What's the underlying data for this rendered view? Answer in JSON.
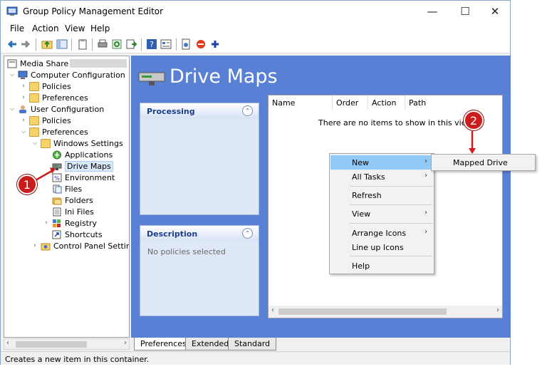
{
  "window": {
    "title": "Group Policy Management Editor",
    "controls": {
      "minimize": "—",
      "maximize": "☐",
      "close": "✕"
    }
  },
  "menu": [
    "File",
    "Action",
    "View",
    "Help"
  ],
  "tree": {
    "root": "Media Share",
    "items": [
      {
        "label": "Computer Configuration",
        "icon": "computer-icon"
      },
      {
        "label": "Policies",
        "icon": "folder-icon"
      },
      {
        "label": "Preferences",
        "icon": "folder-icon"
      },
      {
        "label": "User Configuration",
        "icon": "user-icon"
      },
      {
        "label": "Policies",
        "icon": "folder-icon"
      },
      {
        "label": "Preferences",
        "icon": "folder-icon"
      },
      {
        "label": "Windows Settings",
        "icon": "folder-icon"
      },
      {
        "label": "Applications",
        "icon": "applications-icon"
      },
      {
        "label": "Drive Maps",
        "icon": "drive-maps-icon"
      },
      {
        "label": "Environment",
        "icon": "environment-icon"
      },
      {
        "label": "Files",
        "icon": "files-icon"
      },
      {
        "label": "Folders",
        "icon": "folders-icon"
      },
      {
        "label": "Ini Files",
        "icon": "ini-files-icon"
      },
      {
        "label": "Registry",
        "icon": "registry-icon"
      },
      {
        "label": "Shortcuts",
        "icon": "shortcuts-icon"
      },
      {
        "label": "Control Panel Setting",
        "icon": "control-panel-icon"
      }
    ]
  },
  "main": {
    "title": "Drive Maps",
    "processing": {
      "title": "Processing"
    },
    "description": {
      "title": "Description",
      "text": "No policies selected"
    },
    "columns": [
      "Name",
      "Order",
      "Action",
      "Path"
    ],
    "empty_message": "There are no items to show in this view."
  },
  "context_menu": {
    "items": [
      {
        "label": "New",
        "submenu": true
      },
      {
        "label": "All Tasks",
        "submenu": true
      },
      {
        "label": "Refresh",
        "submenu": false
      },
      {
        "label": "View",
        "submenu": true
      },
      {
        "label": "Arrange Icons",
        "submenu": true
      },
      {
        "label": "Line up Icons",
        "submenu": false
      },
      {
        "label": "Help",
        "submenu": false
      }
    ],
    "submenu": [
      "Mapped Drive"
    ]
  },
  "tabs": [
    "Preferences",
    "Extended",
    "Standard"
  ],
  "status": "Creates a new item in this container.",
  "annotations": [
    "1",
    "2"
  ],
  "colors": {
    "accent": "#5a80d6",
    "highlight": "#91c9f7",
    "annotation": "#cc1b1b"
  }
}
